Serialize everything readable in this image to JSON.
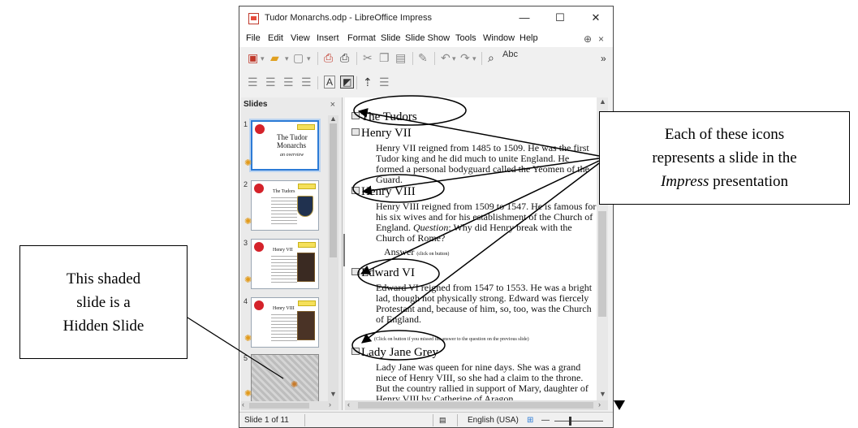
{
  "window": {
    "title": "Tudor Monarchs.odp - LibreOffice Impress",
    "minimize": "—",
    "maximize": "☐",
    "close": "✕"
  },
  "menu": {
    "items": [
      "File",
      "Edit",
      "View",
      "Insert",
      "Format",
      "Slide",
      "Slide Show",
      "Tools",
      "Window",
      "Help"
    ]
  },
  "toolbar": {
    "spellcheck_label": "Abc",
    "more": "»"
  },
  "slides_pane": {
    "header": "Slides",
    "close": "×",
    "thumbnails": [
      {
        "number": "1",
        "title": "The Tudor Monarchs",
        "subtitle": "an overview"
      },
      {
        "number": "2",
        "title": "The Tudors"
      },
      {
        "number": "3",
        "title": "Henry VII"
      },
      {
        "number": "4",
        "title": "Henry VIII"
      },
      {
        "number": "5",
        "title": ""
      }
    ]
  },
  "outline": {
    "slides": [
      {
        "title": "The Tudors",
        "body": ""
      },
      {
        "title": "Henry VII",
        "body": "Henry VII reigned from 1485 to 1509.  He was the first Tudor king and he did much to unite England.  He formed a personal bodyguard called the Yeomen of the Guard."
      },
      {
        "title": "Henry VIII",
        "body_plain": "Henry VIII reigned from 1509 to 1547.  He is famous for his six wives and for his establishment of the Church of England. ",
        "body_italic": "Question",
        "body_tail": ": Why did Henry break with the Church of Rome?",
        "answer": "Answer",
        "answer_note": "(click on button)"
      },
      {
        "title": "Edward VI",
        "body": "Edward VI reigned from 1547 to 1553.  He was a bright lad, though not physically strong.  Edward was fiercely Protestant and, because of him, so, too, was the Church of England.",
        "note": "(Click on button if you missed the answer to the question on the previous slide)"
      },
      {
        "title": "Lady Jane Grey",
        "body": "Lady Jane was queen for nine days.  She was a grand niece of Henry VIII, so she had a claim to the throne.  But the country rallied in support of Mary, daughter of Henry VIII by Catherine of Aragon."
      }
    ]
  },
  "status": {
    "slide": "Slide 1 of 11",
    "language": "English (USA)"
  },
  "callouts": {
    "right_line1": "Each of these icons",
    "right_line2": "represents a slide in the",
    "right_italic": "Impress",
    "right_tail": " presentation",
    "left_line1": "This shaded",
    "left_line2": "slide is a",
    "left_line3": "Hidden Slide"
  },
  "colors": {
    "selection": "#2c7bd6",
    "hidden_slide": "#bdbdbd",
    "accent_red": "#d4222a"
  }
}
